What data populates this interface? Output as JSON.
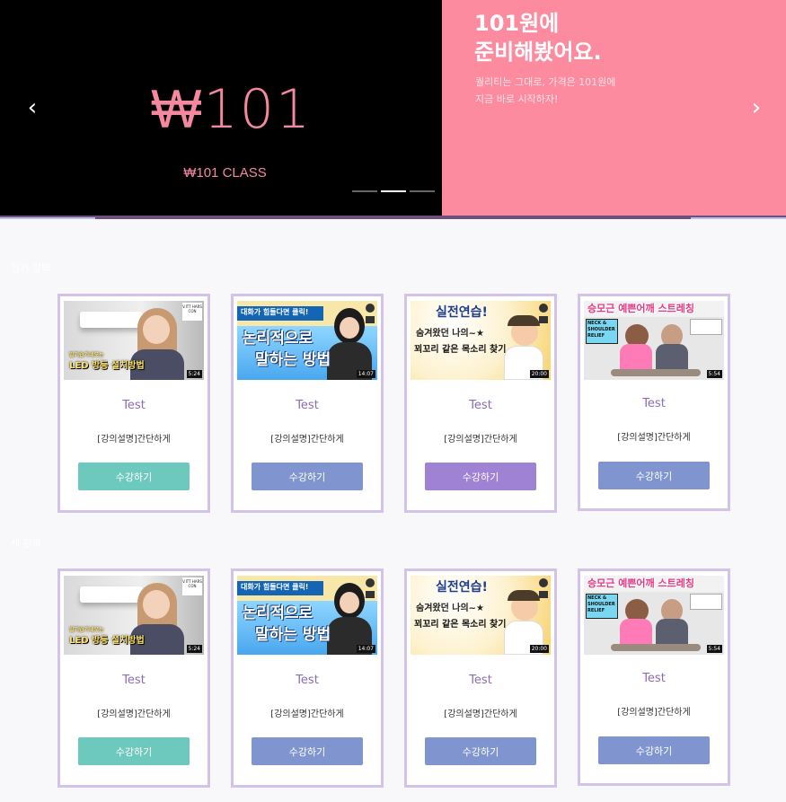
{
  "banner": {
    "logo_text": "₩101",
    "logo_sub": "₩101 CLASS",
    "title_line1": "101원에",
    "title_line2": "준비해봤어요.",
    "desc_line1": "퀄리티는 그대로, 가격은 101원에",
    "desc_line2": "지금 바로 시작하자!",
    "prev_icon": "‹",
    "next_icon": "›",
    "slide_count": 3,
    "active_slide": 2
  },
  "sections": [
    {
      "title": "인기 강의",
      "cards": [
        {
          "thumb": "led",
          "title": "Test",
          "desc": "[강의설명]간단하게",
          "button": "수강하기",
          "button_color": "#6dc8bd",
          "duration": "5:24"
        },
        {
          "thumb": "logic",
          "title": "Test",
          "desc": "[강의설명]간단하게",
          "button": "수강하기",
          "button_color": "#8094cf",
          "duration": "14:07"
        },
        {
          "thumb": "voice",
          "title": "Test",
          "desc": "[강의설명]간단하게",
          "button": "수강하기",
          "button_color": "#9f82d3",
          "duration": "20:00"
        },
        {
          "thumb": "stretch",
          "title": "Test",
          "desc": "[강의설명]간단하게",
          "button": "수강하기",
          "button_color": "#8094cf",
          "duration": "5:54"
        }
      ]
    },
    {
      "title": "새 강의",
      "cards": [
        {
          "thumb": "led",
          "title": "Test",
          "desc": "[강의설명]간단하게",
          "button": "수강하기",
          "button_color": "#6dc8bd",
          "duration": "5:24"
        },
        {
          "thumb": "logic",
          "title": "Test",
          "desc": "[강의설명]간단하게",
          "button": "수강하기",
          "button_color": "#8094cf",
          "duration": "14:07"
        },
        {
          "thumb": "voice",
          "title": "Test",
          "desc": "[강의설명]간단하게",
          "button": "수강하기",
          "button_color": "#8094cf",
          "duration": "20:00"
        },
        {
          "thumb": "stretch",
          "title": "Test",
          "desc": "[강의설명]간단하게",
          "button": "수강하기",
          "button_color": "#8094cf",
          "duration": "5:54"
        }
      ]
    }
  ],
  "thumbs": {
    "led": {
      "line1": "일기습기네오는",
      "line2": "LED 방등 설치방법",
      "badge": "V.ITT HARS CON"
    },
    "logic": {
      "tag": "대화가 힘들다면 클릭!",
      "line1": "논리적으로",
      "line2": "말하는 방법"
    },
    "voice": {
      "line1": "실전연습!",
      "line2": "숨겨왔던 나의~★",
      "line3": "꾀꼬리 같은 목소리 찾기"
    },
    "stretch": {
      "title": "승모근 예쁜어깨 스트레칭",
      "en": "NECK & SHOULDER RELIEF"
    }
  }
}
